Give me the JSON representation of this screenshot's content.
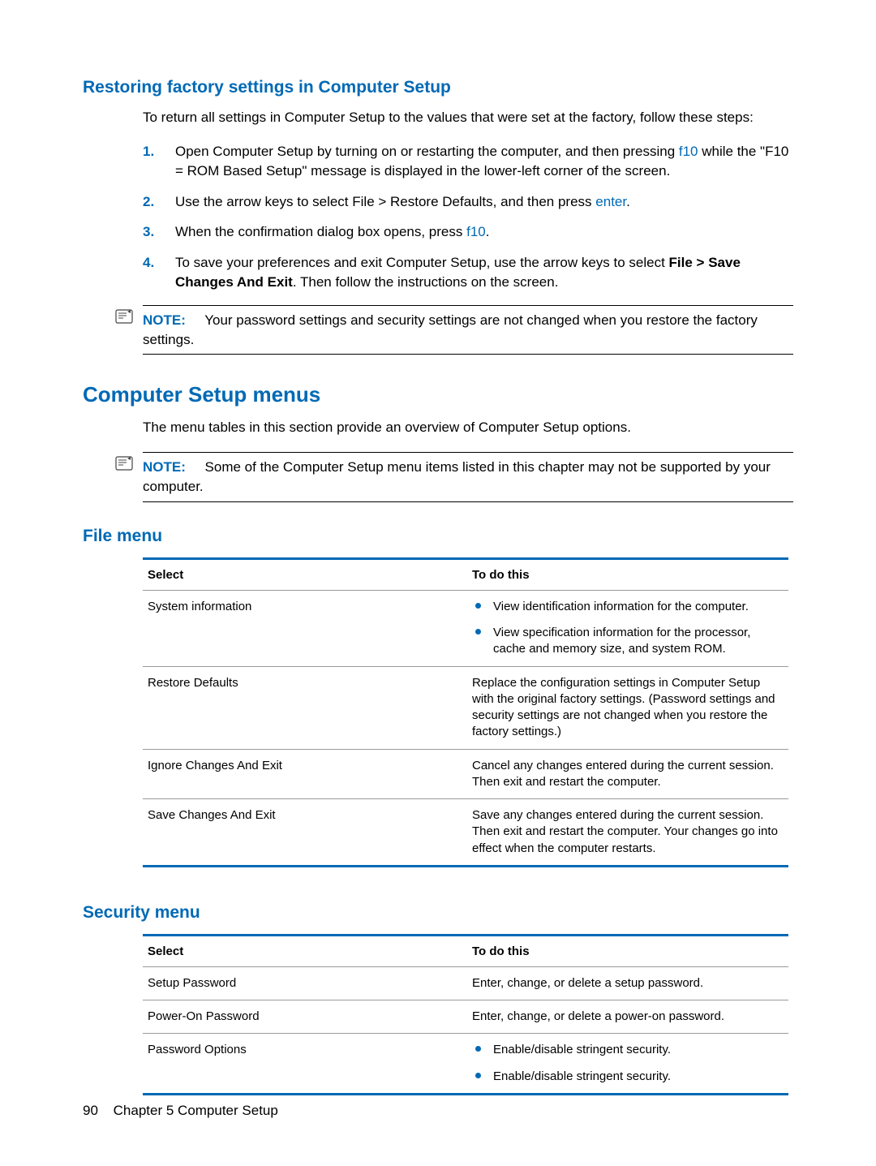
{
  "section1": {
    "heading": "Restoring factory settings in Computer Setup",
    "intro": "To return all settings in Computer Setup to the values that were set at the factory, follow these steps:",
    "steps": [
      {
        "num": "1.",
        "pre": "Open Computer Setup by turning on or restarting the computer, and then pressing ",
        "key": "f10",
        "post": " while the \"F10 = ROM Based Setup\" message is displayed in the lower-left corner of the screen."
      },
      {
        "num": "2.",
        "pre": "Use the arrow keys to select File > Restore Defaults, and then press ",
        "key": "enter",
        "post": "."
      },
      {
        "num": "3.",
        "pre": "When the confirmation dialog box opens, press ",
        "key": "f10",
        "post": "."
      },
      {
        "num": "4.",
        "pre": "To save your preferences and exit Computer Setup, use the arrow keys to select ",
        "bold": "File > Save Changes And Exit",
        "post": ". Then follow the instructions on the screen."
      }
    ],
    "note_label": "NOTE:",
    "note_text": "Your password settings and security settings are not changed when you restore the factory settings."
  },
  "section2": {
    "heading": "Computer Setup menus",
    "intro": "The menu tables in this section provide an overview of Computer Setup options.",
    "note_label": "NOTE:",
    "note_text": "Some of the Computer Setup menu items listed in this chapter may not be supported by your computer."
  },
  "file_menu": {
    "heading": "File menu",
    "col1": "Select",
    "col2": "To do this",
    "rows": [
      {
        "select": "System information",
        "type": "bullets",
        "bullets": [
          "View identification information for the computer.",
          "View specification information for the processor, cache and memory size, and system ROM."
        ]
      },
      {
        "select": "Restore Defaults",
        "type": "text",
        "text": "Replace the configuration settings in Computer Setup with the original factory settings. (Password settings and security settings are not changed when you restore the factory settings.)"
      },
      {
        "select": "Ignore Changes And Exit",
        "type": "text",
        "text": "Cancel any changes entered during the current session. Then exit and restart the computer."
      },
      {
        "select": "Save Changes And Exit",
        "type": "text",
        "text": "Save any changes entered during the current session. Then exit and restart the computer. Your changes go into effect when the computer restarts."
      }
    ]
  },
  "security_menu": {
    "heading": "Security menu",
    "col1": "Select",
    "col2": "To do this",
    "rows": [
      {
        "select": "Setup Password",
        "type": "text",
        "text": "Enter, change, or delete a setup password."
      },
      {
        "select": "Power-On Password",
        "type": "text",
        "text": "Enter, change, or delete a power-on password."
      },
      {
        "select": "Password Options",
        "type": "bullets",
        "bullets": [
          "Enable/disable stringent security.",
          "Enable/disable stringent security."
        ]
      }
    ]
  },
  "footer": {
    "page": "90",
    "chapter": "Chapter 5   Computer Setup"
  }
}
